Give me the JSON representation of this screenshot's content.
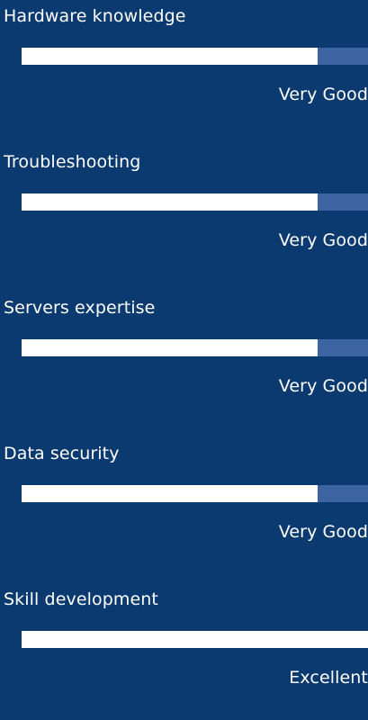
{
  "background_color": "#0b3a70",
  "bar_track_color": "#3b64a0",
  "bar_fill_color": "#ffffff",
  "skills": [
    {
      "name": "Hardware knowledge",
      "rating": "Very Good",
      "level": 0.855
    },
    {
      "name": "Troubleshooting",
      "rating": "Very Good",
      "level": 0.855
    },
    {
      "name": "Servers expertise",
      "rating": "Very Good",
      "level": 0.855
    },
    {
      "name": "Data security",
      "rating": "Very Good",
      "level": 0.855
    },
    {
      "name": "Skill development",
      "rating": "Excellent",
      "level": 1.0
    }
  ]
}
